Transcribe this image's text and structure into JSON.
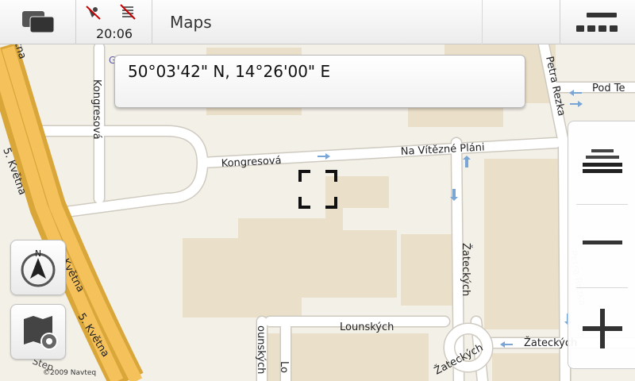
{
  "app": {
    "title": "Maps"
  },
  "status": {
    "time": "20:06"
  },
  "coordinates": {
    "text": "50°03'42\" N, 14°26'00\" E"
  },
  "streets": {
    "petva_kvetna": "5. Května",
    "kongresova": "Kongresová",
    "na_vitezne_plani": "Na Vítězné Pláni",
    "petra_rezka": "Petra Rezka",
    "pod_tere": "Pod Te",
    "zateckych": "Žateckých",
    "lounskych": "Lounských",
    "lo_short": "Lo",
    "ounskych": "ounských",
    "stepanska_part": "Štep",
    "g_label": "G"
  },
  "copyright": "©2009 Navteq",
  "icons": {
    "task_switcher": "task-switcher-icon",
    "gps": "gps-off-icon",
    "signal": "signal-icon",
    "menu": "menu-icon",
    "compass": "compass-icon",
    "map_settings": "map-settings-icon",
    "zoom_level": "zoom-level-icon",
    "zoom_out": "zoom-out-icon",
    "zoom_in": "zoom-in-icon",
    "crosshair": "crosshair-icon"
  }
}
